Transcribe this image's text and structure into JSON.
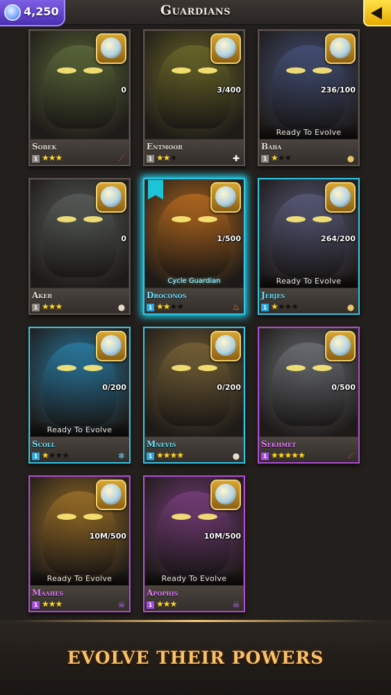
{
  "header": {
    "title": "Guardians",
    "gems": "4,250",
    "gem_icon": "gem-icon",
    "back_icon": "back-arrow-icon"
  },
  "cards": [
    {
      "name": "Sobek",
      "count": "0",
      "level": "1",
      "stars": 3,
      "max_stars": 3,
      "frame": "gray",
      "element_icon": "sword-icon",
      "element_glyph": "⟋",
      "element_color": "#d83a3a",
      "ready": "",
      "art_color": "#5d6b3b"
    },
    {
      "name": "Entmoor",
      "count": "3/400",
      "level": "1",
      "stars": 2,
      "max_stars": 3,
      "frame": "gray",
      "element_icon": "cross-icon",
      "element_glyph": "✚",
      "element_color": "#ffffff",
      "ready": "",
      "art_color": "#6e6a2a"
    },
    {
      "name": "Baba",
      "count": "236/100",
      "level": "1",
      "stars": 1,
      "max_stars": 3,
      "frame": "gray",
      "element_icon": "potion-icon",
      "element_glyph": "●",
      "element_color": "#e7c66c",
      "ready": "Ready To Evolve",
      "art_color": "#46527a"
    },
    {
      "name": "Aker",
      "count": "0",
      "level": "1",
      "stars": 3,
      "max_stars": 3,
      "frame": "gray",
      "element_icon": "orb-icon",
      "element_glyph": "●",
      "element_color": "#e6dccb",
      "ready": "",
      "art_color": "#5a5f5c"
    },
    {
      "name": "Droconos",
      "count": "1/500",
      "level": "1",
      "stars": 2,
      "max_stars": 4,
      "frame": "blue",
      "element_icon": "fire-icon",
      "element_glyph": "♨",
      "element_color": "#ff8a1c",
      "ready": "",
      "cycle_label": "Cycle Guardian",
      "art_color": "#b96c1f"
    },
    {
      "name": "Jerjes",
      "count": "264/200",
      "level": "1",
      "stars": 1,
      "max_stars": 4,
      "frame": "blue",
      "element_icon": "potion-icon",
      "element_glyph": "●",
      "element_color": "#e7c66c",
      "ready": "Ready To Evolve",
      "art_color": "#5a5c7c"
    },
    {
      "name": "Scoll",
      "count": "0/200",
      "level": "1",
      "stars": 1,
      "max_stars": 4,
      "frame": "blue",
      "element_icon": "snowflake-icon",
      "element_glyph": "❄",
      "element_color": "#6ad8ff",
      "ready": "Ready To Evolve",
      "art_color": "#2b7ea6"
    },
    {
      "name": "Mnevis",
      "count": "0/200",
      "level": "1",
      "stars": 4,
      "max_stars": 4,
      "frame": "blue",
      "element_icon": "orb-icon",
      "element_glyph": "●",
      "element_color": "#e6dccb",
      "ready": "",
      "art_color": "#7a6438"
    },
    {
      "name": "Sekhmet",
      "count": "0/500",
      "level": "1",
      "stars": 5,
      "max_stars": 5,
      "frame": "purple",
      "element_icon": "sword-icon",
      "element_glyph": "⟋",
      "element_color": "#d83a3a",
      "ready": "",
      "art_color": "#6f7278"
    },
    {
      "name": "Maahes",
      "count": "10M/500",
      "level": "1",
      "stars": 3,
      "max_stars": 3,
      "frame": "purple",
      "element_icon": "skull-icon",
      "element_glyph": "☠",
      "element_color": "#b36cff",
      "ready": "Ready To Evolve",
      "art_color": "#a07228"
    },
    {
      "name": "Apophis",
      "count": "10M/500",
      "level": "1",
      "stars": 3,
      "max_stars": 3,
      "frame": "purple",
      "element_icon": "skull-icon",
      "element_glyph": "☠",
      "element_color": "#b36cff",
      "ready": "Ready To Evolve",
      "art_color": "#7a3f7e"
    }
  ],
  "footer": {
    "tagline": "EVOLVE THEIR POWERS"
  }
}
